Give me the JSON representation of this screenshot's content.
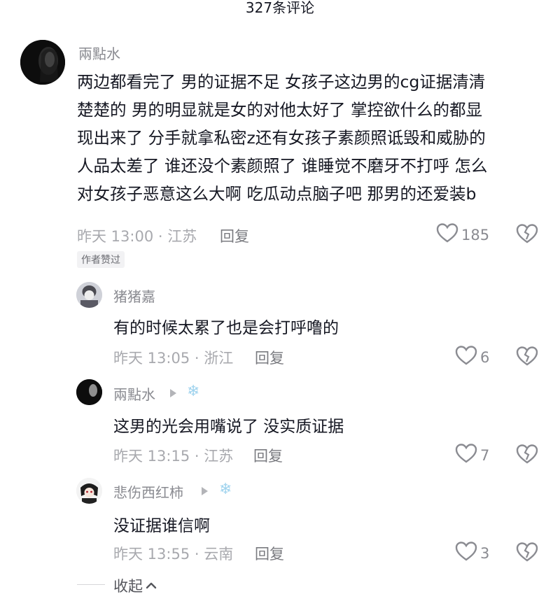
{
  "header": {
    "title": "327条评论"
  },
  "main_comment": {
    "username": "兩點水",
    "lines": [
      "两边都看完了 男的证据不足 女孩子这边男的cg证据清清",
      "楚楚的 男的明显就是女的对他太好了 掌控欲什么的都显",
      "现出来了 分手就拿私密z还有女孩子素颜照诋毁和威胁的",
      "人品太差了 谁还没个素颜照了 谁睡觉不磨牙不打呼 怎么",
      "对女孩子恶意这么大啊 吃瓜动点脑子吧 那男的还爱装b"
    ],
    "meta": "昨天 13:00 · 江苏",
    "reply_label": "回复",
    "like_count": "185",
    "badge": "作者赞过"
  },
  "replies": [
    {
      "username": "猪猪嘉",
      "text": "有的时候太累了也是会打呼噜的",
      "meta": "昨天 13:05 · 浙江",
      "reply_label": "回复",
      "like_count": "6"
    },
    {
      "username": "兩點水",
      "text": "这男的光会用嘴说了 没实质证据",
      "meta": "昨天 13:15 · 江苏",
      "reply_label": "回复",
      "like_count": "7"
    },
    {
      "username": "悲伤西红柿",
      "text": "没证据谁信啊",
      "meta": "昨天 13:55 · 云南",
      "reply_label": "回复",
      "like_count": "3"
    }
  ],
  "collapse_label": "收起",
  "icons": {
    "like": "heart-outline-icon",
    "dislike": "broken-heart-icon",
    "reply_to": "reply-arrow-icon",
    "flair": "snowflake-icon",
    "collapse": "chevron-up-icon"
  }
}
